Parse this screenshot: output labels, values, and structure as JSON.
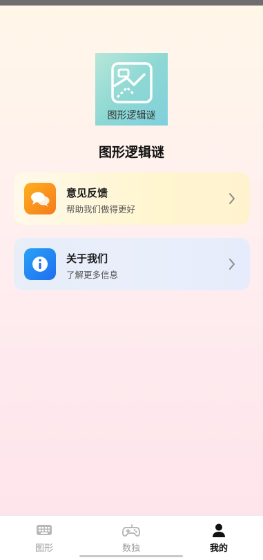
{
  "app": {
    "logo_caption": "图形逻辑谜",
    "title": "图形逻辑谜"
  },
  "cards": [
    {
      "title": "意见反馈",
      "subtitle": "帮助我们做得更好",
      "icon": "chat-bubbles-icon"
    },
    {
      "title": "关于我们",
      "subtitle": "了解更多信息",
      "icon": "info-icon"
    }
  ],
  "tabs": [
    {
      "label": "图形",
      "icon": "keyboard-icon",
      "active": false
    },
    {
      "label": "数独",
      "icon": "gamepad-icon",
      "active": false
    },
    {
      "label": "我的",
      "icon": "person-icon",
      "active": true
    }
  ],
  "colors": {
    "feedback_accent": "#f57a1c",
    "about_accent": "#1f6ef0",
    "logo_bg": "#8ed8d4"
  }
}
